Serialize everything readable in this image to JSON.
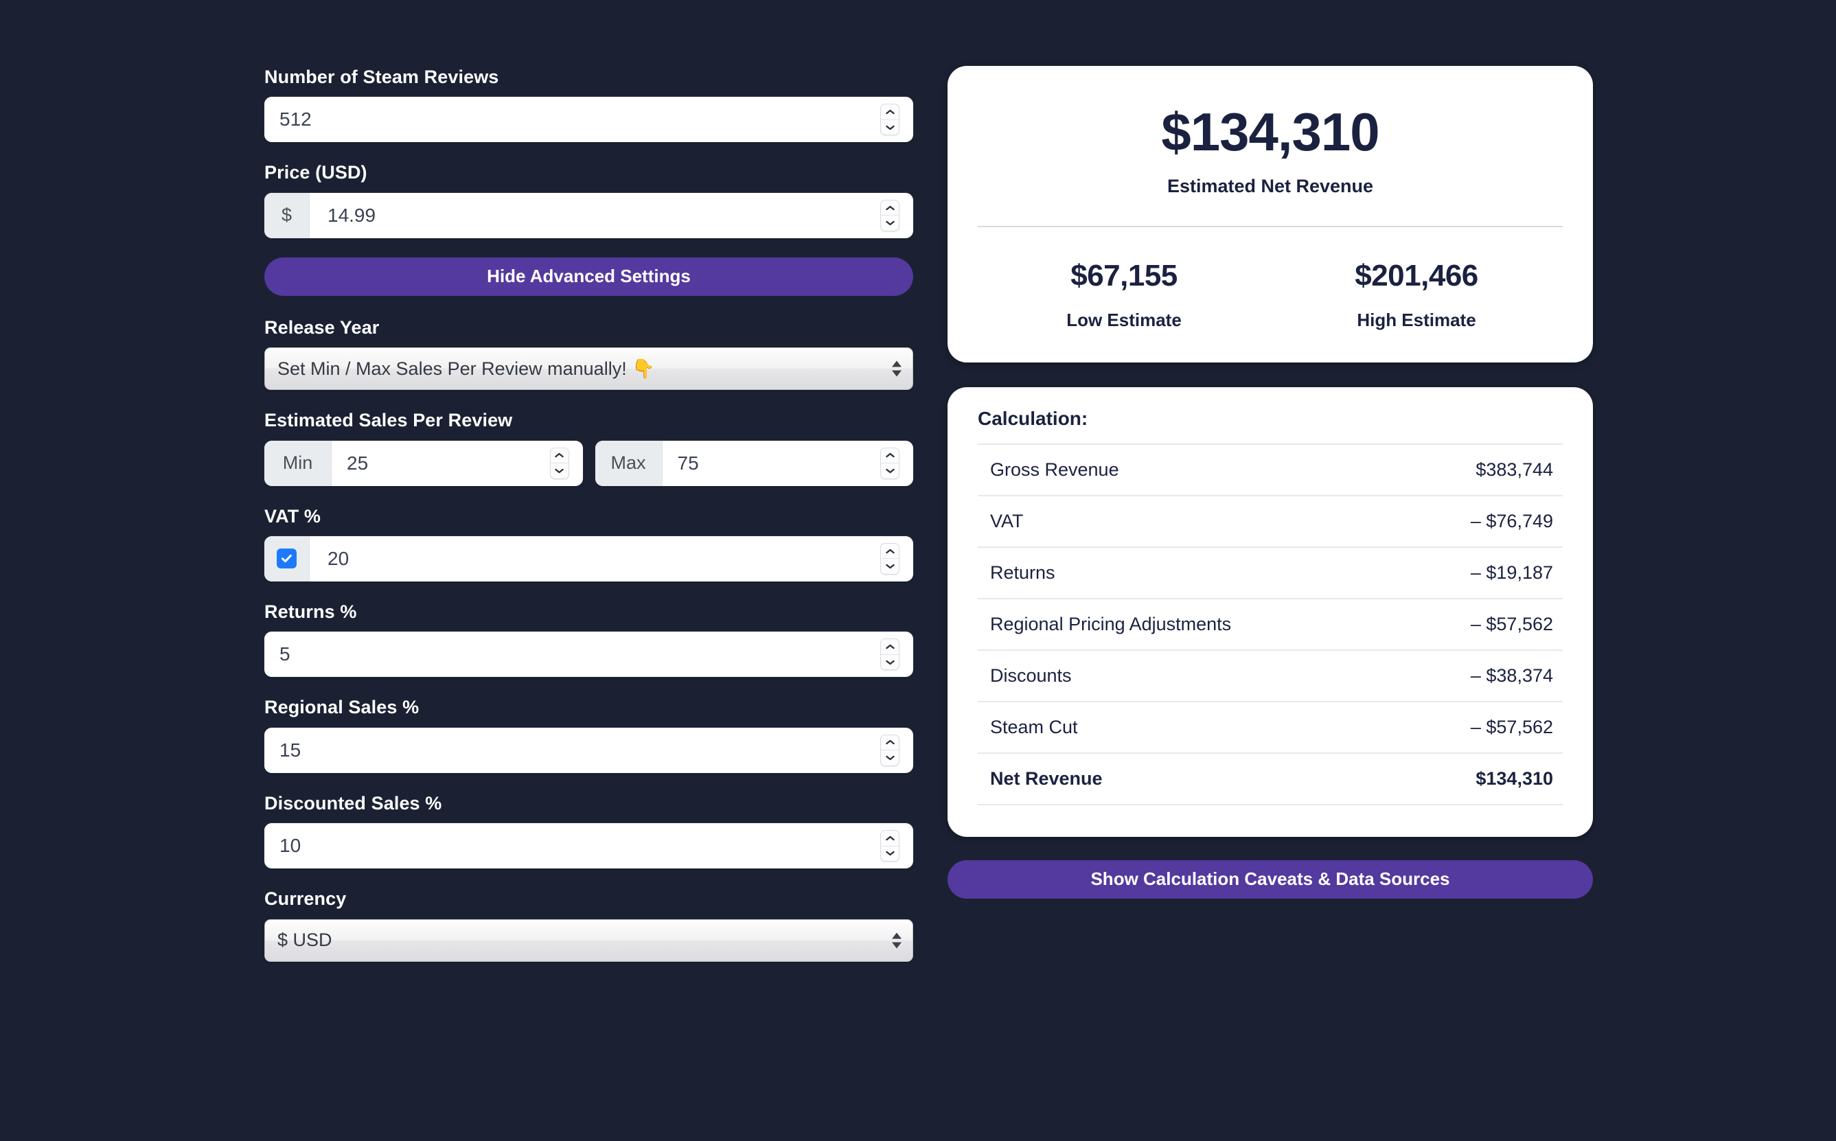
{
  "theme": {
    "background": "#1b2133",
    "accent_purple": "#54399f",
    "card_background": "#ffffff",
    "text_dark": "#1b2240",
    "checkbox_blue": "#1d7afc"
  },
  "form": {
    "reviews": {
      "label": "Number of Steam Reviews",
      "value": "512"
    },
    "price": {
      "label": "Price (USD)",
      "prefix": "$",
      "value": "14.99"
    },
    "advanced_toggle_label": "Hide Advanced Settings",
    "release_year": {
      "label": "Release Year",
      "selected": "Set Min / Max Sales Per Review manually! 👇"
    },
    "sales_per_review": {
      "label": "Estimated Sales Per Review",
      "min_addon": "Min",
      "min_value": "25",
      "max_addon": "Max",
      "max_value": "75"
    },
    "vat": {
      "label": "VAT %",
      "value": "20",
      "checked": true
    },
    "returns": {
      "label": "Returns %",
      "value": "5"
    },
    "regional_sales": {
      "label": "Regional Sales %",
      "value": "15"
    },
    "discounted_sales": {
      "label": "Discounted Sales %",
      "value": "10"
    },
    "currency": {
      "label": "Currency",
      "selected": "$  USD"
    }
  },
  "summary": {
    "net_revenue": "$134,310",
    "net_revenue_caption": "Estimated Net Revenue",
    "low_value": "$67,155",
    "low_label": "Low Estimate",
    "high_value": "$201,466",
    "high_label": "High Estimate"
  },
  "calculation": {
    "title": "Calculation:",
    "rows": [
      {
        "label": "Gross Revenue",
        "value": "$383,744"
      },
      {
        "label": "VAT",
        "value": "– $76,749"
      },
      {
        "label": "Returns",
        "value": "– $19,187"
      },
      {
        "label": "Regional Pricing Adjustments",
        "value": "– $57,562"
      },
      {
        "label": "Discounts",
        "value": "– $38,374"
      },
      {
        "label": "Steam Cut",
        "value": "– $57,562"
      },
      {
        "label": "Net Revenue",
        "value": "$134,310",
        "total": true
      }
    ]
  },
  "caveats_button_label": "Show Calculation Caveats & Data Sources"
}
